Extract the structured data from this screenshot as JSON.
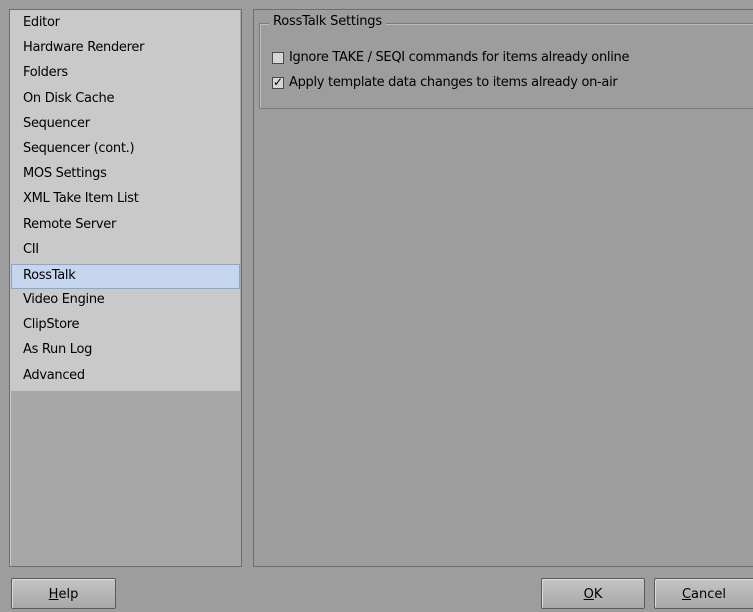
{
  "sidebar": {
    "items": [
      {
        "label": "Editor"
      },
      {
        "label": "Hardware Renderer"
      },
      {
        "label": "Folders"
      },
      {
        "label": "On Disk Cache"
      },
      {
        "label": "Sequencer"
      },
      {
        "label": "Sequencer (cont.)"
      },
      {
        "label": "MOS Settings"
      },
      {
        "label": "XML Take Item List"
      },
      {
        "label": "Remote Server"
      },
      {
        "label": "CII"
      },
      {
        "label": "RossTalk"
      },
      {
        "label": "Video Engine"
      },
      {
        "label": "ClipStore"
      },
      {
        "label": "As Run Log"
      },
      {
        "label": "Advanced"
      }
    ],
    "selected": "RossTalk"
  },
  "panel": {
    "group_title": "RossTalk Settings",
    "options": [
      {
        "label": "Ignore TAKE / SEQI commands for items already online",
        "checked": false
      },
      {
        "label": "Apply template data changes to items already on-air",
        "checked": true
      }
    ]
  },
  "buttons": {
    "help": {
      "mnemonic": "H",
      "rest": "elp"
    },
    "ok": {
      "mnemonic": "O",
      "rest": "K"
    },
    "cancel": {
      "mnemonic": "C",
      "rest": "ancel"
    }
  },
  "colors": {
    "window_bg": "#9d9d9d",
    "list_bg": "#c9c9c9",
    "selection_bg": "#c6d6ee",
    "selection_border": "#8aa6cf"
  }
}
